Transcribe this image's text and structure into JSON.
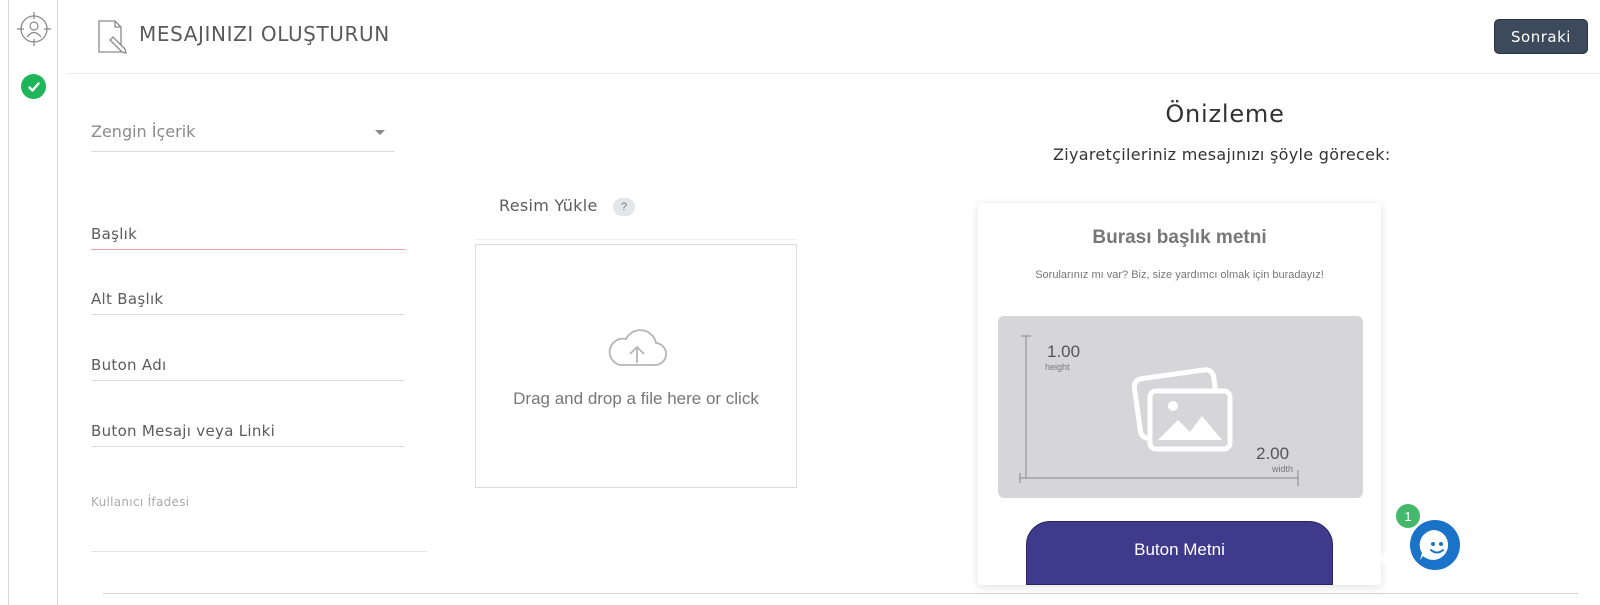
{
  "rail": {
    "target_icon": "target-user-icon",
    "check_icon": "check-circle-icon"
  },
  "header": {
    "icon": "document-edit-icon",
    "title": "MESAJINIZI OLUŞTURUN",
    "next_label": "Sonraki"
  },
  "form": {
    "content_type": "Zengin İçerik",
    "title_label": "Başlık",
    "subtitle_label": "Alt Başlık",
    "button_name_label": "Buton Adı",
    "button_message_label": "Buton Mesajı veya Linki",
    "user_expression_label": "Kullanıcı İfadesi"
  },
  "upload": {
    "label": "Resim Yükle",
    "help": "?",
    "dropzone_text": "Drag and drop a file here or click",
    "icon": "cloud-upload-icon"
  },
  "preview": {
    "title": "Önizleme",
    "subtitle": "Ziyaretçileriniz mesajınızı şöyle görecek:",
    "card_title": "Burası başlık metni",
    "card_subtitle": "Sorularınız mı var? Biz, size yardımcı olmak için buradayız!",
    "image_height": "1.00",
    "image_height_label": "height",
    "image_width": "2.00",
    "image_width_label": "width",
    "button_label": "Buton Metni",
    "colors": {
      "button": "#3e3a8c",
      "placeholder": "#d6d6d8"
    }
  },
  "chat": {
    "badge_count": "1",
    "icon": "chat-face-icon",
    "color": "#1a73c8"
  },
  "colors": {
    "next_button": "#3d4a5b",
    "success": "#1fb55a",
    "active_underline": "#f0a0a8"
  }
}
